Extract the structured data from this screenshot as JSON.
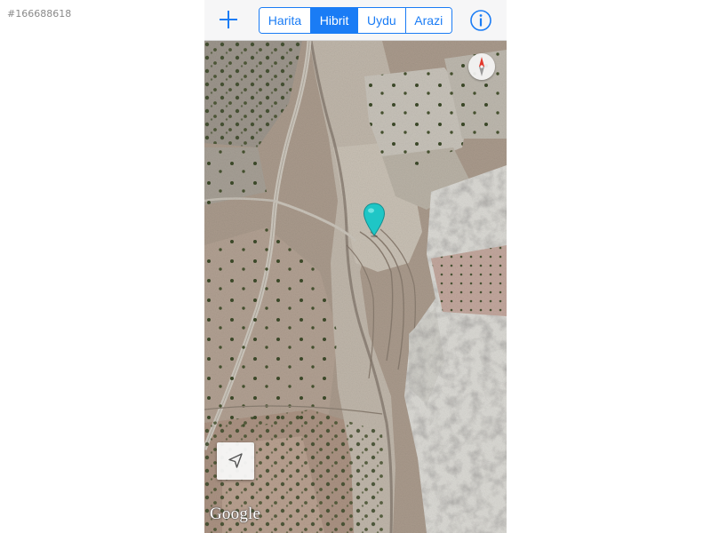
{
  "watermark": "#166688618",
  "toolbar": {
    "add_icon": "plus-icon",
    "info_icon": "info-icon"
  },
  "map_types": [
    {
      "label": "Harita",
      "active": false
    },
    {
      "label": "Hibrit",
      "active": true
    },
    {
      "label": "Uydu",
      "active": false
    },
    {
      "label": "Arazi",
      "active": false
    }
  ],
  "map": {
    "attribution": "Google",
    "compass_icon": "compass-icon",
    "pin_icon": "map-pin-icon",
    "locate_icon": "location-arrow-icon",
    "colors": {
      "accent": "#1a7cf5",
      "pin": "#1fc6c6",
      "terrain": "#a99a8c",
      "road": "#c9c4bb",
      "tree": "#3d4a2a",
      "rock": "#e2e2de"
    }
  }
}
